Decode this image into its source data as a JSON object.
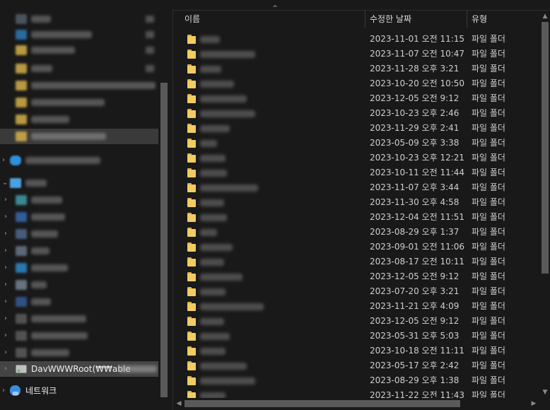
{
  "nav": {
    "network_drive_label": "DavWWWRoot(₩₩able",
    "network_label": "네트워크"
  },
  "header": {
    "name": "이름",
    "modified": "수정한 날짜",
    "type": "유형"
  },
  "files": [
    {
      "date": "2023-11-01 오전 11:15",
      "type": "파일 폴더"
    },
    {
      "date": "2023-11-07 오전 10:47",
      "type": "파일 폴더"
    },
    {
      "date": "2023-11-28 오후 3:21",
      "type": "파일 폴더"
    },
    {
      "date": "2023-10-20 오전 10:50",
      "type": "파일 폴더"
    },
    {
      "date": "2023-12-05 오전 9:12",
      "type": "파일 폴더"
    },
    {
      "date": "2023-10-23 오후 2:46",
      "type": "파일 폴더"
    },
    {
      "date": "2023-11-29 오후 2:41",
      "type": "파일 폴더"
    },
    {
      "date": "2023-05-09 오후 3:38",
      "type": "파일 폴더"
    },
    {
      "date": "2023-10-23 오후 12:21",
      "type": "파일 폴더"
    },
    {
      "date": "2023-10-11 오전 11:44",
      "type": "파일 폴더"
    },
    {
      "date": "2023-11-07 오후 3:44",
      "type": "파일 폴더"
    },
    {
      "date": "2023-11-30 오후 4:58",
      "type": "파일 폴더"
    },
    {
      "date": "2023-12-04 오전 11:51",
      "type": "파일 폴더"
    },
    {
      "date": "2023-08-29 오후 1:37",
      "type": "파일 폴더"
    },
    {
      "date": "2023-09-01 오전 11:06",
      "type": "파일 폴더"
    },
    {
      "date": "2023-08-17 오전 10:11",
      "type": "파일 폴더"
    },
    {
      "date": "2023-12-05 오전 9:12",
      "type": "파일 폴더"
    },
    {
      "date": "2023-07-20 오후 3:21",
      "type": "파일 폴더"
    },
    {
      "date": "2023-11-21 오후 4:09",
      "type": "파일 폴더"
    },
    {
      "date": "2023-12-05 오전 9:12",
      "type": "파일 폴더"
    },
    {
      "date": "2023-05-31 오후 5:03",
      "type": "파일 폴더"
    },
    {
      "date": "2023-10-18 오전 11:11",
      "type": "파일 폴더"
    },
    {
      "date": "2023-05-17 오후 2:42",
      "type": "파일 폴더"
    },
    {
      "date": "2023-08-29 오후 1:38",
      "type": "파일 폴더"
    },
    {
      "date": "2023-11-22 오전 11:43",
      "type": "파일 폴더"
    }
  ],
  "colors": {
    "background": "#191919",
    "folder": "#f0cc63",
    "selected_row": "#3a3a3a",
    "text": "#e6e6e6"
  }
}
